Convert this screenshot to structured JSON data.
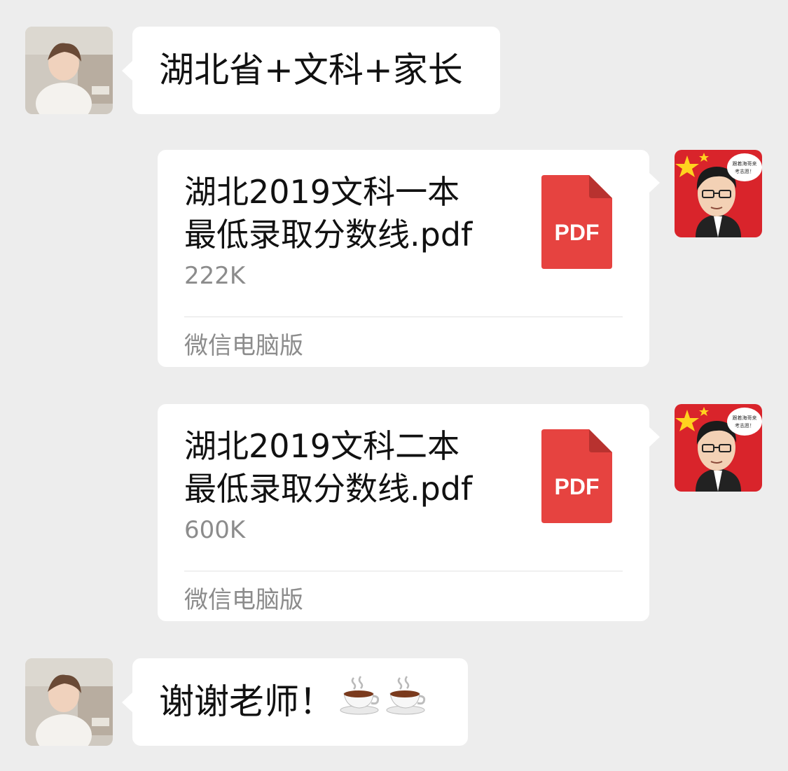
{
  "messages": [
    {
      "type": "text",
      "sender": "parent",
      "text": "湖北省+文科+家长"
    },
    {
      "type": "file",
      "sender": "teacher",
      "file_name_line1": "湖北2019文科一本",
      "file_name_line2": "最低录取分数线.pdf",
      "file_size": "222K",
      "source": "微信电脑版",
      "icon_label": "PDF"
    },
    {
      "type": "file",
      "sender": "teacher",
      "file_name_line1": "湖北2019文科二本",
      "file_name_line2": "最低录取分数线.pdf",
      "file_size": "600K",
      "source": "微信电脑版",
      "icon_label": "PDF"
    },
    {
      "type": "text",
      "sender": "parent",
      "text": "谢谢老师！",
      "emojis": [
        "hot-beverage-icon",
        "hot-beverage-icon"
      ]
    }
  ],
  "avatars": {
    "parent": {
      "icon": "child-photo-avatar"
    },
    "teacher": {
      "icon": "cartoon-teacher-avatar",
      "speech_text": [
        "跟着海哥来",
        "考志愿！"
      ]
    }
  },
  "colors": {
    "background": "#ededed",
    "bubble": "#ffffff",
    "pdf_red": "#e64340",
    "secondary_text": "#8c8c8c"
  }
}
